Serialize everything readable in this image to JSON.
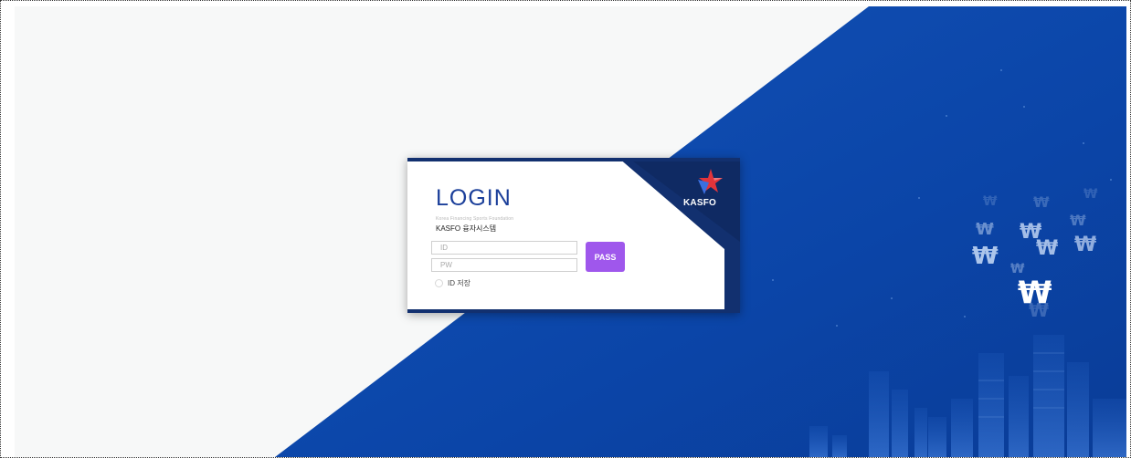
{
  "login": {
    "title": "LOGIN",
    "foundation_name": "Korea Financing Sports Foundation",
    "system_name": "KASFO 융자시스템",
    "id_placeholder": "ID",
    "pw_placeholder": "PW",
    "pass_button": "PASS",
    "remember_label": "ID 저장"
  },
  "logo": {
    "text": "KASFO"
  },
  "colors": {
    "background_light": "#f7f8f8",
    "background_blue": "#0b45a8",
    "card_navy": "#12306f",
    "title_blue": "#1b3f9a",
    "pass_purple": "#9f57ec",
    "logo_red": "#e2343a",
    "logo_blue": "#3a6fe0"
  },
  "icons": {
    "won_symbols": "won-currency-icon",
    "logo": "kasfo-star-logo-icon"
  }
}
